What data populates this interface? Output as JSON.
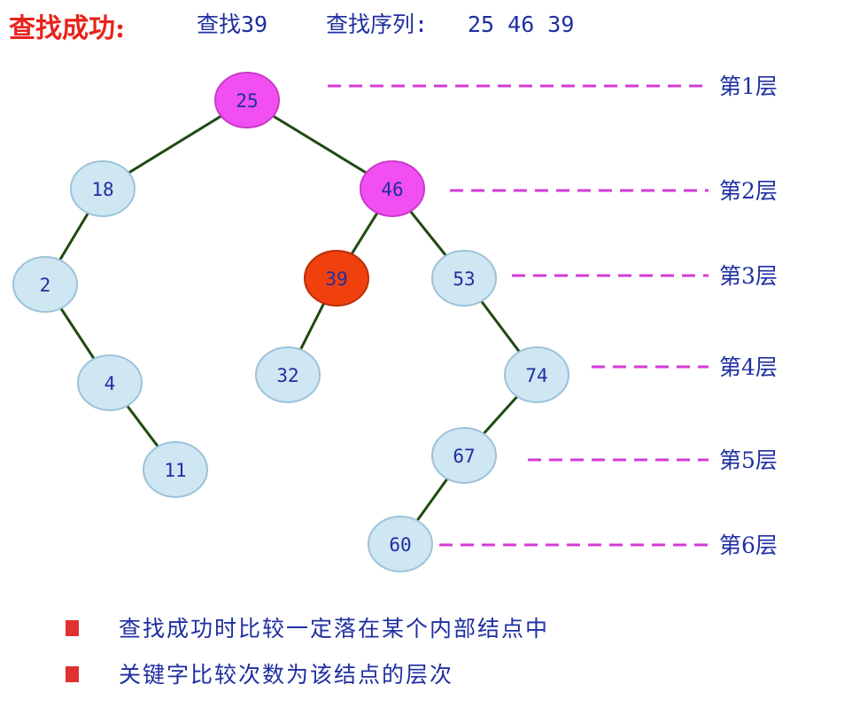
{
  "header": {
    "title": "查找成功:",
    "target": "查找39",
    "sequence_label": "查找序列:",
    "sequence": "25 46 39"
  },
  "colors": {
    "title": "#e8231c",
    "text": "#1f2fa0",
    "node_fill": "#cfe6f3",
    "node_stroke": "#9cc3d9",
    "path_fill": "#f24ff2",
    "found_fill": "#f0400e",
    "edge": "#1f4a12",
    "level_line": "#d63ad6",
    "bullet": "#e03030"
  },
  "tree": {
    "nodes": [
      {
        "id": "25",
        "label": "25",
        "state": "path"
      },
      {
        "id": "18",
        "label": "18",
        "state": "normal"
      },
      {
        "id": "46",
        "label": "46",
        "state": "path"
      },
      {
        "id": "2",
        "label": "2",
        "state": "normal"
      },
      {
        "id": "39",
        "label": "39",
        "state": "found"
      },
      {
        "id": "53",
        "label": "53",
        "state": "normal"
      },
      {
        "id": "4",
        "label": "4",
        "state": "normal"
      },
      {
        "id": "32",
        "label": "32",
        "state": "normal"
      },
      {
        "id": "74",
        "label": "74",
        "state": "normal"
      },
      {
        "id": "11",
        "label": "11",
        "state": "normal"
      },
      {
        "id": "67",
        "label": "67",
        "state": "normal"
      },
      {
        "id": "60",
        "label": "60",
        "state": "normal"
      }
    ],
    "edges": [
      [
        "25",
        "18"
      ],
      [
        "25",
        "46"
      ],
      [
        "18",
        "2"
      ],
      [
        "2",
        "4"
      ],
      [
        "4",
        "11"
      ],
      [
        "46",
        "39"
      ],
      [
        "46",
        "53"
      ],
      [
        "39",
        "32"
      ],
      [
        "53",
        "74"
      ],
      [
        "74",
        "67"
      ],
      [
        "67",
        "60"
      ]
    ]
  },
  "levels": [
    {
      "id": "1",
      "label": "第1层"
    },
    {
      "id": "2",
      "label": "第2层"
    },
    {
      "id": "3",
      "label": "第3层"
    },
    {
      "id": "4",
      "label": "第4层"
    },
    {
      "id": "5",
      "label": "第5层"
    },
    {
      "id": "6",
      "label": "第6层"
    }
  ],
  "notes": [
    {
      "icon": "square-bullet-icon",
      "text": "查找成功时比较一定落在某个内部结点中"
    },
    {
      "icon": "square-bullet-icon",
      "text": "关键字比较次数为该结点的层次"
    }
  ]
}
